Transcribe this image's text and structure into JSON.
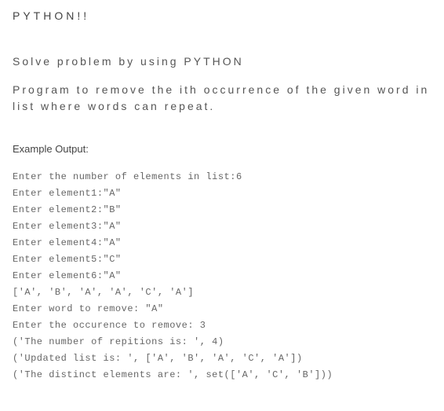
{
  "title": "PYTHON!!",
  "heading": "Solve problem by using PYTHON",
  "description": "Program to remove the ith occurrence of the given word in list where words can repeat.",
  "example_label": "Example Output:",
  "output": [
    "Enter the number of elements in list:6",
    "Enter element1:\"A\"",
    "Enter element2:\"B\"",
    "Enter element3:\"A\"",
    "Enter element4:\"A\"",
    "Enter element5:\"C\"",
    "Enter element6:\"A\"",
    "['A', 'B', 'A', 'A', 'C', 'A']",
    "Enter word to remove: \"A\"",
    "Enter the occurence to remove: 3",
    "('The number of repitions is: ', 4)",
    "('Updated list is: ', ['A', 'B', 'A', 'C', 'A'])",
    "('The distinct elements are: ', set(['A', 'C', 'B']))"
  ]
}
